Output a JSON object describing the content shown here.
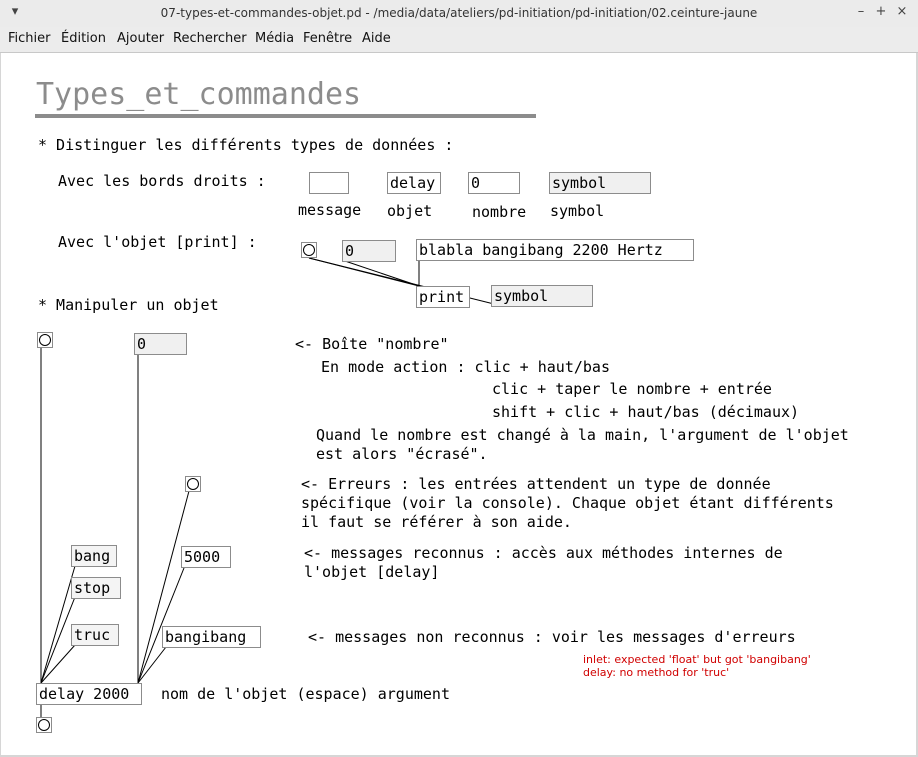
{
  "window": {
    "title": "07-types-et-commandes-objet.pd  - /media/data/ateliers/pd-initiation/pd-initiation/02.ceinture-jaune",
    "menu_icon": "chevron-down-icon",
    "controls": [
      "–",
      "+",
      "×"
    ]
  },
  "menu": [
    "Fichier",
    "Édition",
    "Ajouter",
    "Rechercher",
    "Média",
    "Fenêtre",
    "Aide"
  ],
  "patch": {
    "heading": "Types_et_commandes",
    "section1": "* Distinguer les différents types de données :",
    "bords_droits": "Avec les bords droits :",
    "labels": {
      "message": "message",
      "objet": "objet",
      "nombre": "nombre",
      "symbol": "symbol"
    },
    "demo_boxes": {
      "delay": "delay",
      "number": "0",
      "symbol": "symbol"
    },
    "print_row": "Avec l'objet [print] :",
    "print_number": "0",
    "print_message": "blabla bangibang 2200 Hertz",
    "print_object": "print",
    "print_symbol": "symbol",
    "section2": "* Manipuler un objet",
    "number_top": "0",
    "nombre_title": "<- Boîte \"nombre\"",
    "nombre_lines": [
      "En mode action : clic + haut/bas",
      "clic + taper le nombre + entrée",
      "shift + clic + haut/bas (décimaux)"
    ],
    "nombre_note": "Quand le nombre est changé à la main, l'argument de l'objet\nest alors \"écrasé\".",
    "errors_text": "<- Erreurs : les entrées attendent un type de donnée\nspécifique (voir la console). Chaque objet étant différents\nil faut se référer à son aide.",
    "msg_bang": "bang",
    "msg_stop": "stop",
    "msg_truc": "truc",
    "msg_5000": "5000",
    "msg_bangibang": "bangibang",
    "reconnus": "<- messages reconnus : accès aux méthodes internes de\nl'objet [delay]",
    "non_reconnus": "<- messages non reconnus : voir les messages d'erreurs",
    "errors": [
      "inlet: expected 'float' but got 'bangibang'",
      "delay: no method for 'truc'"
    ],
    "delay_object": "delay 2000",
    "delay_caption": "nom de l'objet (espace) argument"
  }
}
